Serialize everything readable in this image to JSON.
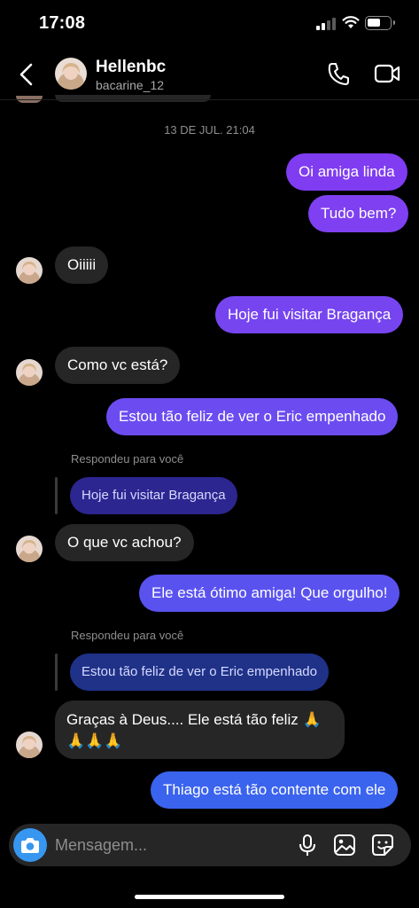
{
  "status_bar": {
    "time": "17:08"
  },
  "header": {
    "name": "Hellenbc",
    "username": "bacarine_12"
  },
  "timestamp": "13 DE JUL. 21:04",
  "replied_label": "Respondeu para você",
  "messages": {
    "m1": "Oi amiga linda",
    "m2": "Tudo bem?",
    "m3": "Oiiiii",
    "m4": "Hoje fui visitar Bragança",
    "m5": "Como vc está?",
    "m6": "Estou tão feliz de ver o Eric empenhado",
    "r1_quote": "Hoje fui visitar Bragança",
    "m7": "O que vc achou?",
    "m8": "Ele está ótimo amiga! Que orgulho!",
    "r2_quote": "Estou tão feliz de ver o Eric empenhado",
    "m9_line1": "Graças à Deus.... Ele está tão feliz 🙏",
    "m9_line2": "🙏🙏🙏",
    "m10": "Thiago está tão contente com ele"
  },
  "composer": {
    "placeholder": "Mensagem..."
  },
  "icons": [
    "back-icon",
    "phone-icon",
    "video-icon",
    "camera-icon",
    "microphone-icon",
    "gallery-icon",
    "sticker-icon"
  ],
  "colors": {
    "outgoing_purple": "#7b3cf0",
    "outgoing_blue": "#4a55ee",
    "incoming": "#262626",
    "camera": "#3797f0"
  }
}
